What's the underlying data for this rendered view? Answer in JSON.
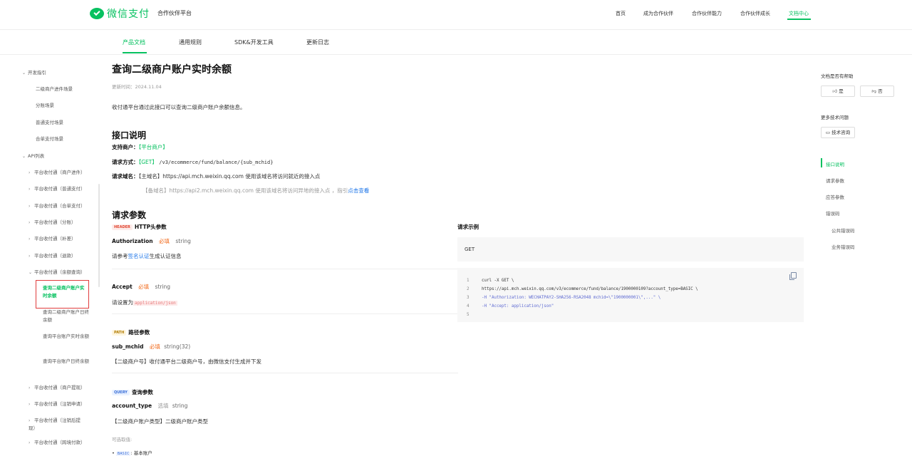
{
  "header": {
    "logo_text": "微信支付",
    "platform": "合作伙伴平台",
    "nav": [
      "首页",
      "成为合作伙伴",
      "合作伙伴能力",
      "合作伙伴成长",
      "文档中心"
    ],
    "active_nav": "文档中心"
  },
  "subnav": {
    "items": [
      "产品文档",
      "通用规则",
      "SDK&开发工具",
      "更新日志"
    ],
    "active": "产品文档"
  },
  "sidebar": {
    "dev_guide": "开发指引",
    "dev_children": [
      "二级商户进件场景",
      "分账场景",
      "普通支付场景",
      "合单支付场景"
    ],
    "api_list": "API列表",
    "api_groups_before": [
      "平台收付通（商户进件）",
      "平台收付通（普通支付）",
      "平台收付通（合单支付）",
      "平台收付通（分账）",
      "平台收付通（补差）",
      "平台收付通（退款）",
      "平台收付通（余额查询）"
    ],
    "selected": "查询二级商户账户实时余额",
    "balance_children": [
      "查询二级商户账户日终余额",
      "查询平台账户实时余额",
      "查询平台账户日终余额"
    ],
    "api_groups_after": [
      "平台收付通（商户提现）",
      "平台收付通（注销申请）",
      "平台收付通（注销后提现）",
      "平台收付通（跨境付款）"
    ]
  },
  "content": {
    "title": "查询二级商户账户实时余额",
    "updated": "更新时间：2024.11.04",
    "intro": "收付通平台通过此接口可以查询二级商户账户余额信息。",
    "section_interface": "接口说明",
    "support_label": "支持商户：",
    "support_value": "【平台商户】",
    "method_label": "请求方式：",
    "method_value": "【GET】",
    "method_path": "/v3/ecommerce/fund/balance/{sub_mchid}",
    "domain_label": "请求域名：",
    "domain_value": "【主域名】https://api.mch.weixin.qq.com 使用该域名将访问就近的接入点",
    "backup_domain": "【备域名】https://api2.mch.weixin.qq.com 使用该域名将访问异地的接入点 ，指引",
    "backup_link": "点击查看",
    "section_params": "请求参数",
    "header_tag": "HEADER",
    "header_title": "HTTP头参数",
    "auth_name": "Authorization",
    "required": "必填",
    "string_type": "string",
    "auth_desc_pre": "请参考",
    "auth_desc_link": "签名认证",
    "auth_desc_post": "生成认证信息",
    "accept_name": "Accept",
    "accept_desc_pre": "请设置为",
    "accept_desc_code": "application/json",
    "path_tag": "PATH",
    "path_title": "路径参数",
    "sub_mchid_name": "sub_mchid",
    "sub_mchid_type": "string(32)",
    "sub_mchid_desc": "【二级商户号】收付通平台二级商户号，由微信支付生成并下发",
    "query_tag": "QUERY",
    "query_title": "查询参数",
    "account_type_name": "account_type",
    "optional": "选填",
    "account_type_desc": "【二级商户账户类型】二级商户账户类型",
    "options_label": "可选取值:",
    "option_code": "BASIC",
    "option_text": ": 基本账户"
  },
  "example": {
    "title": "请求示例",
    "method": "GET",
    "lines": [
      "curl -X GET \\",
      "  https://api.mch.weixin.qq.com/v3/ecommerce/fund/balance/1900000109?account_type=BASIC \\",
      "  -H \"Authorization: WECHATPAY2-SHA256-RSA2048 mchid=\\\"1900000001\\\",...\" \\",
      "  -H \"Accept: application/json\"",
      ""
    ],
    "line_numbers": [
      "1",
      "2",
      "3",
      "4",
      "5"
    ]
  },
  "right_panel": {
    "helpful_label": "文档是否有帮助",
    "yes": "是",
    "no": "否",
    "more_label": "更多技术问题",
    "consult": "技术咨询",
    "toc": [
      "接口说明",
      "请求参数",
      "应答参数",
      "错误码",
      "公共错误码",
      "业务错误码"
    ],
    "toc_active": "接口说明"
  },
  "colors": {
    "brand": "#07c160",
    "required": "#f26b1d",
    "link": "#1a73e8"
  }
}
